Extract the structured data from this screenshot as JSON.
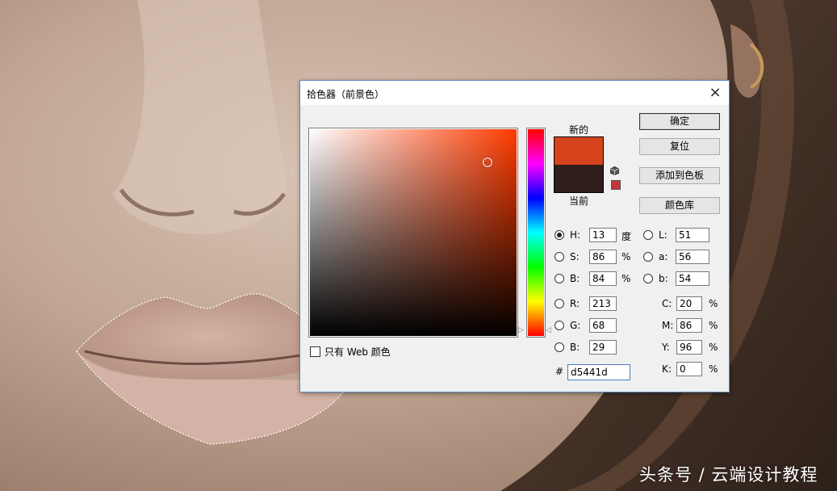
{
  "dialog": {
    "title": "拾色器（前景色）",
    "close_icon": "×",
    "new_label": "新的",
    "current_label": "当前",
    "new_color": "#d5441d",
    "current_color": "#2e1d1a",
    "gamut_color": "#c4343c",
    "web_only_label": "只有 Web 颜色",
    "buttons": {
      "ok": "确定",
      "reset": "复位",
      "add_to_swatches": "添加到色板",
      "color_libraries": "颜色库"
    },
    "fields": {
      "h": {
        "label": "H:",
        "value": "13",
        "unit": "度",
        "selected": true
      },
      "s": {
        "label": "S:",
        "value": "86",
        "unit": "%"
      },
      "b": {
        "label": "B:",
        "value": "84",
        "unit": "%"
      },
      "r": {
        "label": "R:",
        "value": "213"
      },
      "g": {
        "label": "G:",
        "value": "68"
      },
      "b2": {
        "label": "B:",
        "value": "29"
      },
      "L": {
        "label": "L:",
        "value": "51"
      },
      "a": {
        "label": "a:",
        "value": "56"
      },
      "lab_b": {
        "label": "b:",
        "value": "54"
      },
      "c": {
        "label": "C:",
        "value": "20",
        "unit": "%"
      },
      "m": {
        "label": "M:",
        "value": "86",
        "unit": "%"
      },
      "y": {
        "label": "Y:",
        "value": "96",
        "unit": "%"
      },
      "k": {
        "label": "K:",
        "value": "0",
        "unit": "%"
      },
      "hex": {
        "label": "#",
        "value": "d5441d"
      }
    },
    "saturation": 0.86,
    "brightness": 0.84
  },
  "watermark": "头条号 / 云端设计教程",
  "icons": [
    "close-icon",
    "cube-icon",
    "gamut-warning-icon"
  ]
}
